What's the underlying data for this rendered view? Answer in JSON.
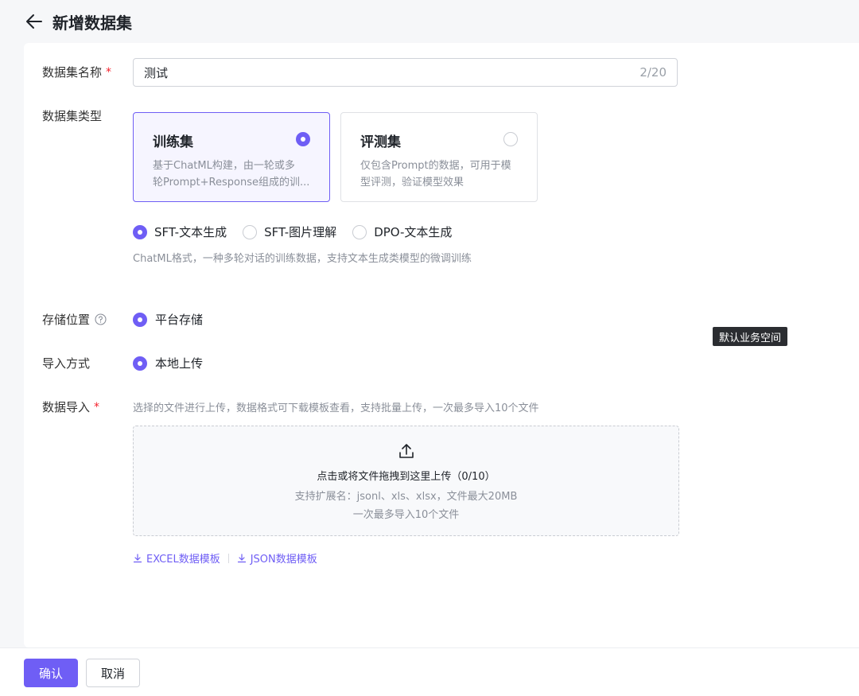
{
  "header": {
    "title": "新增数据集",
    "back_icon": "arrow-left-icon"
  },
  "form": {
    "name": {
      "label": "数据集名称",
      "required": "*",
      "value": "测试",
      "counter": "2/20"
    },
    "type": {
      "label": "数据集类型",
      "cards": [
        {
          "title": "训练集",
          "desc_line1": "基于ChatML构建，由一轮或多",
          "desc_line2": "轮Prompt+Response组成的训...",
          "selected": true
        },
        {
          "title": "评测集",
          "desc_line1": "仅包含Prompt的数据，可用于模",
          "desc_line2": "型评测，验证模型效果",
          "selected": false
        }
      ],
      "subtypes": [
        {
          "label": "SFT-文本生成",
          "selected": true
        },
        {
          "label": "SFT-图片理解",
          "selected": false
        },
        {
          "label": "DPO-文本生成",
          "selected": false
        }
      ],
      "hint": "ChatML格式，一种多轮对话的训练数据，支持文本生成类模型的微调训练"
    },
    "storage": {
      "label": "存储位置",
      "option": "平台存储",
      "tooltip": "默认业务空间"
    },
    "import_method": {
      "label": "导入方式",
      "option": "本地上传"
    },
    "data_import": {
      "label": "数据导入",
      "required": "*",
      "hint": "选择的文件进行上传，数据格式可下载模板查看，支持批量上传，一次最多导入10个文件",
      "upload": {
        "main": "点击或将文件拖拽到这里上传（0/10）",
        "sub": "支持扩展名：jsonl、xls、xlsx，文件最大20MB",
        "sub2": "一次最多导入10个文件"
      },
      "templates": [
        "EXCEL数据模板",
        "JSON数据模板"
      ]
    }
  },
  "footer": {
    "confirm": "确认",
    "cancel": "取消"
  },
  "colors": {
    "accent": "#6f5ef5",
    "required": "#f5222d"
  }
}
